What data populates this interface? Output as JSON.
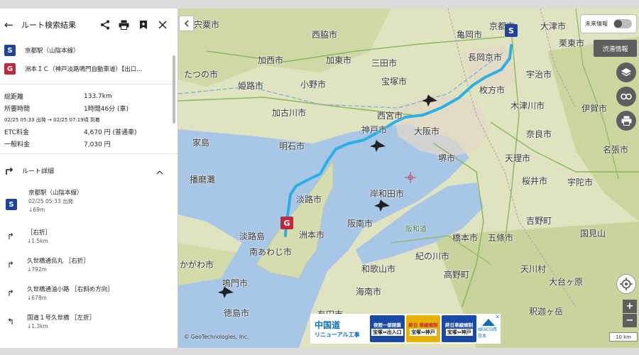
{
  "panel": {
    "title": "ルート検索結果",
    "back_icon": "←",
    "start": {
      "badge": "S",
      "name": "京都駅（山陰本線）"
    },
    "goal": {
      "badge": "G",
      "name": "洲本ＩＣ（神戸淡路鳴門自動車道）【出口..."
    },
    "stats": {
      "distance_label": "総距離",
      "distance": "133.7km",
      "time_label": "所要時間",
      "time": "1時間46分 (車)",
      "schedule": "02/25 05:33 出発 → 02/25 07:19頃 到着",
      "etc_label": "ETC料金",
      "etc": "4,670 円 (普通車)",
      "general_label": "一般料金",
      "general": "7,030 円"
    },
    "detail_label": "ルート詳細",
    "steps": [
      {
        "badge": "S",
        "line1": "京都駅（山陰本線）",
        "line2": "02/25 05:33 出発",
        "line3": "↓69m"
      },
      {
        "glyph": "↱",
        "line1": "［右折］",
        "line2": "↓1.5km"
      },
      {
        "glyph": "↱",
        "line1": "久世橋通烏丸 ［右折］",
        "line2": "↓792m"
      },
      {
        "glyph": "↱",
        "line1": "久世橋通油小路 ［右斜め方向］",
        "line2": "↓678m"
      },
      {
        "glyph": "↰",
        "line1": "国道１号久世橋 ［左折］",
        "line2": "↓1.3km"
      }
    ]
  },
  "map": {
    "future_label": "未来情報",
    "traffic_label": "渋滞情報",
    "scale": "10 km",
    "copyright": "© GeoTechnologies, Inc.",
    "zoom_in": "+",
    "zoom_out": "−",
    "route_color": "#2ab0e6",
    "start_badge": "S",
    "goal_badge": "G",
    "cities": [
      {
        "name": "宍粟市"
      },
      {
        "name": "西脇市"
      },
      {
        "name": "亀岡市"
      },
      {
        "name": "大津市"
      },
      {
        "name": "京都市"
      },
      {
        "name": "栗東市"
      },
      {
        "name": "加西市"
      },
      {
        "name": "加東市"
      },
      {
        "name": "三田市"
      },
      {
        "name": "長岡京市"
      },
      {
        "name": "たつの市"
      },
      {
        "name": "姫路市"
      },
      {
        "name": "小野市"
      },
      {
        "name": "宝塚市"
      },
      {
        "name": "宇治市"
      },
      {
        "name": "枚方市"
      },
      {
        "name": "西宮市"
      },
      {
        "name": "加古川市"
      },
      {
        "name": "神戸市"
      },
      {
        "name": "大阪市"
      },
      {
        "name": "木津川市"
      },
      {
        "name": "伊賀市"
      },
      {
        "name": "家島"
      },
      {
        "name": "明石市"
      },
      {
        "name": "奈良市"
      },
      {
        "name": "名張市"
      },
      {
        "name": "堺市"
      },
      {
        "name": "天理市"
      },
      {
        "name": "播磨灘"
      },
      {
        "name": "桜井市"
      },
      {
        "name": "宇陀市"
      },
      {
        "name": "淡路市"
      },
      {
        "name": "岸和田市"
      },
      {
        "name": "吉野町"
      },
      {
        "name": "淡路島"
      },
      {
        "name": "洲本市"
      },
      {
        "name": "阪南市"
      },
      {
        "name": "橋本市"
      },
      {
        "name": "五條市"
      },
      {
        "name": "国見山"
      },
      {
        "name": "南あわじ市"
      },
      {
        "name": "紀の川市"
      },
      {
        "name": "かがわ市"
      },
      {
        "name": "和歌山市"
      },
      {
        "name": "高野町"
      },
      {
        "name": "天川村"
      },
      {
        "name": "鳴門市"
      },
      {
        "name": "大台ヶ原"
      },
      {
        "name": "海南市"
      },
      {
        "name": "徳島市"
      },
      {
        "name": "有田市"
      },
      {
        "name": "釈迦ヶ岳"
      },
      {
        "name": "阪和道"
      }
    ]
  },
  "ad": {
    "brand1": "中国道",
    "brand2": "リニューアル工事",
    "cells": [
      {
        "top": "夜間一部閉鎖",
        "bottom": "宝塚⇔出入口",
        "color": "#1a4aa8"
      },
      {
        "top": "終日 車線規制",
        "bottom": "宝塚⇔神戸",
        "color": "#e8b000"
      },
      {
        "top": "終日車線規制",
        "bottom": "宝塚⇔神戸",
        "color": "#1a4aa8"
      }
    ],
    "logo": "NEXCO西日本",
    "close": "✕"
  }
}
